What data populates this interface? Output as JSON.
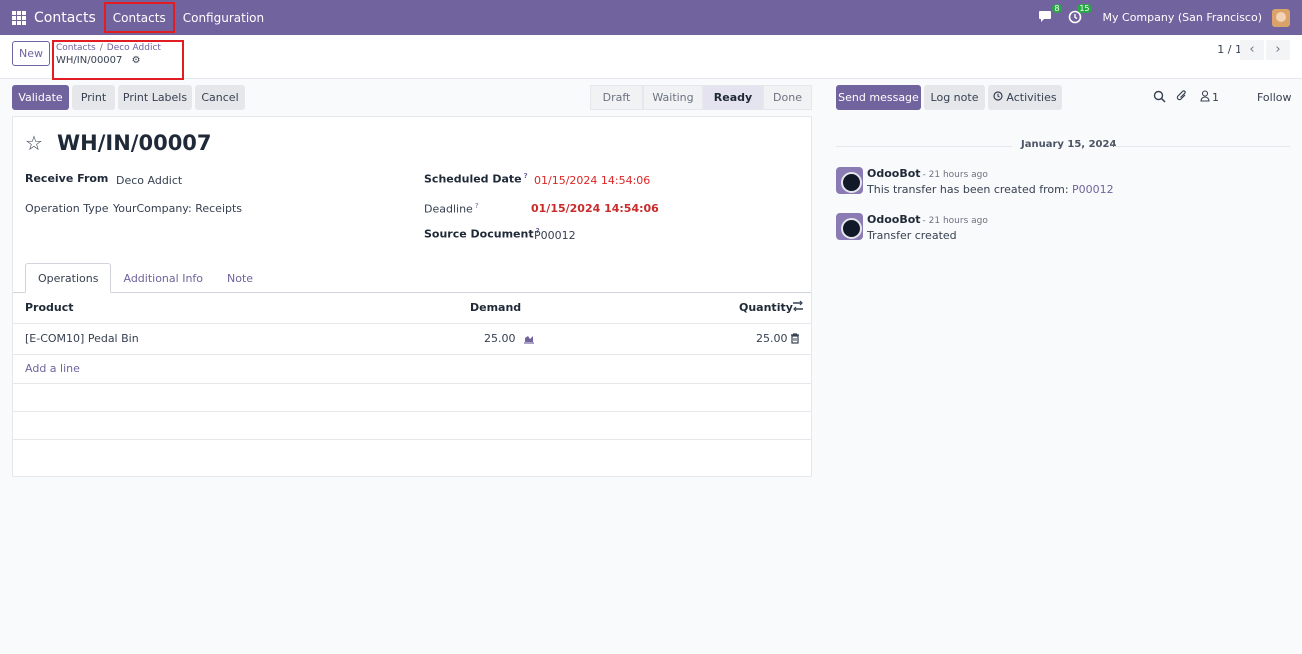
{
  "navbar": {
    "app_name": "Contacts",
    "menus": [
      "Contacts",
      "Configuration"
    ],
    "messages_count": "8",
    "activities_count": "15",
    "company": "My Company (San Francisco)"
  },
  "control": {
    "new_label": "New",
    "breadcrumb": [
      "Contacts",
      "Deco Addict"
    ],
    "breadcrumb_sep": "/",
    "current": "WH/IN/00007",
    "pager": "1 / 1"
  },
  "actions": {
    "validate": "Validate",
    "print": "Print",
    "print_labels": "Print Labels",
    "cancel": "Cancel"
  },
  "status": {
    "stages": [
      "Draft",
      "Waiting",
      "Ready",
      "Done"
    ],
    "active": "Ready"
  },
  "form": {
    "title": "WH/IN/00007",
    "receive_from_label": "Receive From",
    "receive_from": "Deco Addict",
    "operation_type_label": "Operation Type",
    "operation_type": "YourCompany: Receipts",
    "scheduled_date_label": "Scheduled Date",
    "scheduled_date": "01/15/2024 14:54:06",
    "deadline_label": "Deadline",
    "deadline": "01/15/2024 14:54:06",
    "source_document_label": "Source Document",
    "source_document": "P00012",
    "help_mark": "?"
  },
  "tabs": [
    "Operations",
    "Additional Info",
    "Note"
  ],
  "table": {
    "headers": {
      "product": "Product",
      "demand": "Demand",
      "quantity": "Quantity"
    },
    "rows": [
      {
        "product": "[E-COM10] Pedal Bin",
        "demand": "25.00",
        "quantity": "25.00"
      }
    ],
    "add_line": "Add a line"
  },
  "chatter": {
    "send_message": "Send message",
    "log_note": "Log note",
    "activities": "Activities",
    "followers_count": "1",
    "follow": "Follow",
    "date": "January 15, 2024",
    "messages": [
      {
        "author": "OdooBot",
        "time": "- 21 hours ago",
        "body": "This transfer has been created from: ",
        "link": "P00012"
      },
      {
        "author": "OdooBot",
        "time": "- 21 hours ago",
        "body": "Transfer created",
        "link": ""
      }
    ]
  },
  "colors": {
    "brand": "#71639e",
    "red_date": "#dc2626",
    "badge": "#28a745"
  }
}
